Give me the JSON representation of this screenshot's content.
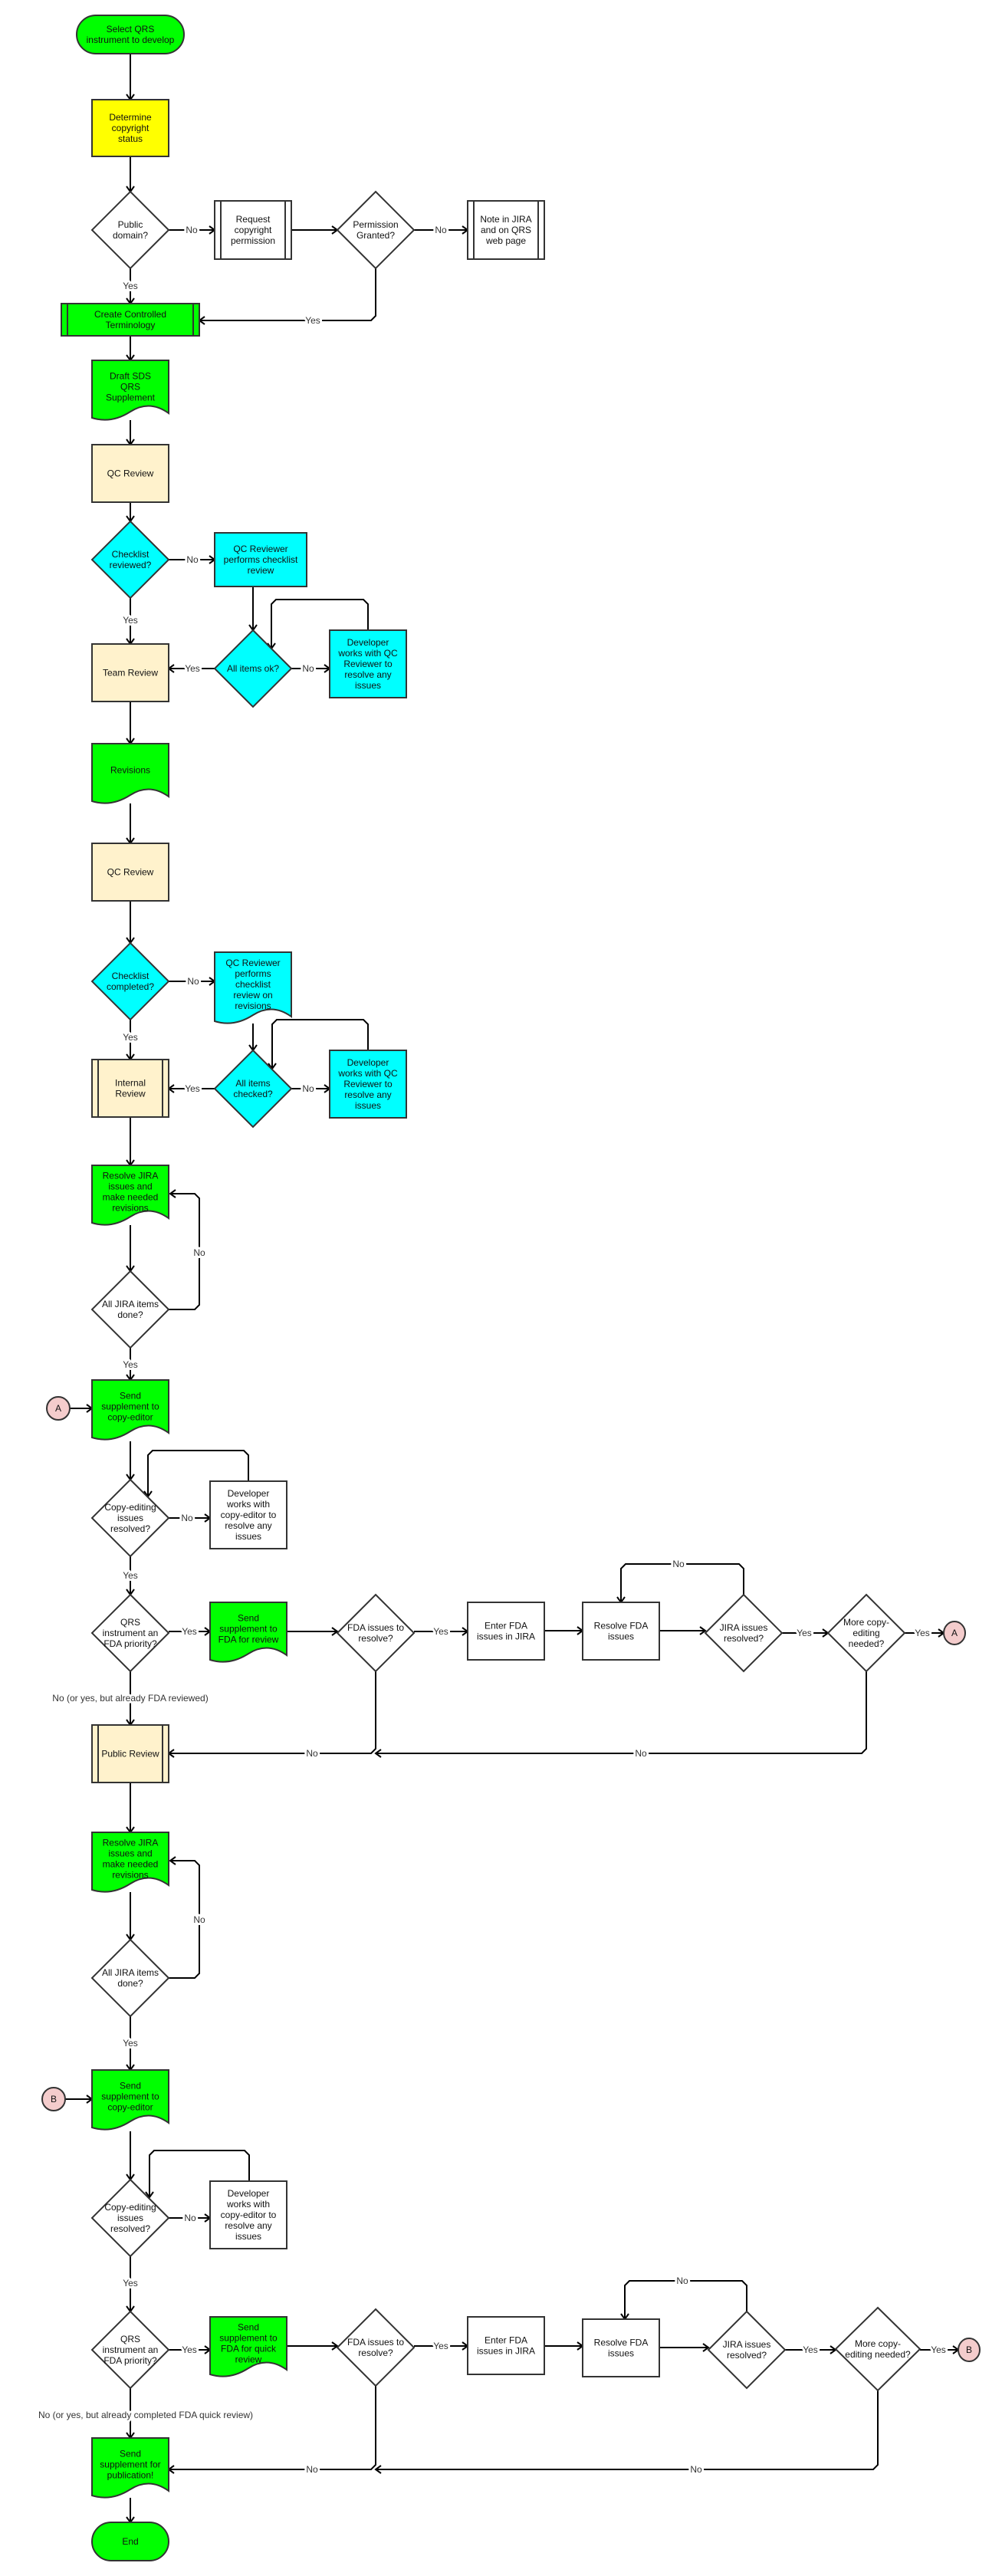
{
  "colors": {
    "green": "#00ff00",
    "yellow": "#ffff00",
    "cyan": "#00ffff",
    "cream": "#fff2cc",
    "white": "#ffffff",
    "pink": "#f4cccc",
    "stroke": "#333333",
    "edge": "#000000"
  },
  "nodes": [
    {
      "id": "start",
      "shape": "terminal",
      "fill": "green",
      "lines": [
        "Select QRS",
        "instrument to develop"
      ]
    },
    {
      "id": "determine",
      "shape": "process",
      "fill": "yellow",
      "lines": [
        "Determine",
        "copyright",
        "status"
      ]
    },
    {
      "id": "public",
      "shape": "decision",
      "fill": "white",
      "lines": [
        "Public",
        "domain?"
      ]
    },
    {
      "id": "request",
      "shape": "subprocess",
      "fill": "white",
      "lines": [
        "Request",
        "copyright",
        "permission"
      ]
    },
    {
      "id": "permission",
      "shape": "decision",
      "fill": "white",
      "lines": [
        "Permission",
        "Granted?"
      ]
    },
    {
      "id": "note",
      "shape": "subprocess",
      "fill": "white",
      "lines": [
        "Note in JIRA",
        "and on QRS",
        "web page"
      ]
    },
    {
      "id": "create",
      "shape": "subprocess",
      "fill": "green",
      "lines": [
        "Create Controlled",
        "Terminology"
      ]
    },
    {
      "id": "draft",
      "shape": "document",
      "fill": "green",
      "lines": [
        "Draft SDS",
        "QRS",
        "Supplement"
      ]
    },
    {
      "id": "qc1",
      "shape": "process",
      "fill": "cream",
      "lines": [
        "QC Review"
      ]
    },
    {
      "id": "checklist1",
      "shape": "decision",
      "fill": "cyan",
      "lines": [
        "Checklist",
        "reviewed?"
      ]
    },
    {
      "id": "qcr1",
      "shape": "process",
      "fill": "cyan",
      "lines": [
        "QC Reviewer",
        "performs checklist",
        "review"
      ]
    },
    {
      "id": "team",
      "shape": "process",
      "fill": "cream",
      "lines": [
        "Team Review"
      ]
    },
    {
      "id": "allok",
      "shape": "decision",
      "fill": "cyan",
      "lines": [
        "All items ok?"
      ]
    },
    {
      "id": "dev1",
      "shape": "process",
      "fill": "cyan",
      "lines": [
        "Developer",
        "works with QC",
        "Reviewer to",
        "resolve any",
        "issues"
      ]
    },
    {
      "id": "revisions",
      "shape": "document",
      "fill": "green",
      "lines": [
        "Revisions"
      ]
    },
    {
      "id": "qc2",
      "shape": "process",
      "fill": "cream",
      "lines": [
        "QC Review"
      ]
    },
    {
      "id": "checklist2",
      "shape": "decision",
      "fill": "cyan",
      "lines": [
        "Checklist",
        "completed?"
      ]
    },
    {
      "id": "qcr2",
      "shape": "document",
      "fill": "cyan",
      "lines": [
        "QC Reviewer",
        "performs",
        "checklist",
        "review on",
        "revisions"
      ]
    },
    {
      "id": "internal",
      "shape": "subprocess",
      "fill": "cream",
      "lines": [
        "Internal",
        "Review"
      ]
    },
    {
      "id": "allchecked",
      "shape": "decision",
      "fill": "cyan",
      "lines": [
        "All items",
        "checked?"
      ]
    },
    {
      "id": "dev2",
      "shape": "process",
      "fill": "cyan",
      "lines": [
        "Developer",
        "works with QC",
        "Reviewer to",
        "resolve any",
        "issues"
      ]
    },
    {
      "id": "resolve1",
      "shape": "document",
      "fill": "green",
      "lines": [
        "Resolve JIRA",
        "issues and",
        "make needed",
        "revisions"
      ]
    },
    {
      "id": "alljira1",
      "shape": "decision",
      "fill": "white",
      "lines": [
        "All JIRA items",
        "done?"
      ]
    },
    {
      "id": "send1",
      "shape": "document",
      "fill": "green",
      "lines": [
        "Send",
        "supplement to",
        "copy-editor"
      ]
    },
    {
      "id": "connA1",
      "shape": "connector",
      "fill": "pink",
      "lines": [
        "A"
      ]
    },
    {
      "id": "copyed1",
      "shape": "decision",
      "fill": "white",
      "lines": [
        "Copy-editing",
        "issues",
        "resolved?"
      ]
    },
    {
      "id": "devce1",
      "shape": "process",
      "fill": "white",
      "lines": [
        "Developer",
        "works with",
        "copy-editor to",
        "resolve any",
        "issues"
      ]
    },
    {
      "id": "prio1",
      "shape": "decision",
      "fill": "white",
      "lines": [
        "QRS",
        "instrument an",
        "FDA priority?"
      ]
    },
    {
      "id": "sendfda1",
      "shape": "document",
      "fill": "green",
      "lines": [
        "Send",
        "supplement to",
        "FDA for review"
      ]
    },
    {
      "id": "fdaiss1",
      "shape": "decision",
      "fill": "white",
      "lines": [
        "FDA issues to",
        "resolve?"
      ]
    },
    {
      "id": "enter1",
      "shape": "process",
      "fill": "white",
      "lines": [
        "Enter FDA",
        "issues in JIRA"
      ]
    },
    {
      "id": "resfda1",
      "shape": "process",
      "fill": "white",
      "lines": [
        "Resolve FDA",
        "issues"
      ]
    },
    {
      "id": "jirares1",
      "shape": "decision",
      "fill": "white",
      "lines": [
        "JIRA issues",
        "resolved?"
      ]
    },
    {
      "id": "more1",
      "shape": "decision",
      "fill": "white",
      "lines": [
        "More copy-",
        "editing",
        "needed?"
      ]
    },
    {
      "id": "connA2",
      "shape": "connector",
      "fill": "pink",
      "lines": [
        "A"
      ]
    },
    {
      "id": "publicreview",
      "shape": "subprocess",
      "fill": "cream",
      "lines": [
        "Public Review"
      ]
    },
    {
      "id": "resolve2",
      "shape": "document",
      "fill": "green",
      "lines": [
        "Resolve JIRA",
        "issues and",
        "make needed",
        "revisions"
      ]
    },
    {
      "id": "alljira2",
      "shape": "decision",
      "fill": "white",
      "lines": [
        "All JIRA items",
        "done?"
      ]
    },
    {
      "id": "send2",
      "shape": "document",
      "fill": "green",
      "lines": [
        "Send",
        "supplement to",
        "copy-editor"
      ]
    },
    {
      "id": "connB1",
      "shape": "connector",
      "fill": "pink",
      "lines": [
        "B"
      ]
    },
    {
      "id": "copyed2",
      "shape": "decision",
      "fill": "white",
      "lines": [
        "Copy-editing",
        "issues",
        "resolved?"
      ]
    },
    {
      "id": "devce2",
      "shape": "process",
      "fill": "white",
      "lines": [
        "Developer",
        "works with",
        "copy-editor to",
        "resolve any",
        "issues"
      ]
    },
    {
      "id": "prio2",
      "shape": "decision",
      "fill": "white",
      "lines": [
        "QRS",
        "instrument an",
        "FDA priority?"
      ]
    },
    {
      "id": "sendfda2",
      "shape": "document",
      "fill": "green",
      "lines": [
        "Send",
        "supplement to",
        "FDA for quick",
        "review"
      ]
    },
    {
      "id": "fdaiss2",
      "shape": "decision",
      "fill": "white",
      "lines": [
        "FDA issues to",
        "resolve?"
      ]
    },
    {
      "id": "enter2",
      "shape": "process",
      "fill": "white",
      "lines": [
        "Enter FDA",
        "issues in JIRA"
      ]
    },
    {
      "id": "resfda2",
      "shape": "process",
      "fill": "white",
      "lines": [
        "Resolve FDA",
        "issues"
      ]
    },
    {
      "id": "jirares2",
      "shape": "decision",
      "fill": "white",
      "lines": [
        "JIRA issues",
        "resolved?"
      ]
    },
    {
      "id": "more2",
      "shape": "decision",
      "fill": "white",
      "lines": [
        "More copy-",
        "editing needed?"
      ]
    },
    {
      "id": "connB2",
      "shape": "connector",
      "fill": "pink",
      "lines": [
        "B"
      ]
    },
    {
      "id": "publication",
      "shape": "document",
      "fill": "green",
      "lines": [
        "Send",
        "supplement for",
        "publication!"
      ]
    },
    {
      "id": "end",
      "shape": "terminal",
      "fill": "green",
      "lines": [
        "End"
      ]
    }
  ],
  "edges": [
    {
      "from": "start",
      "to": "determine",
      "label": ""
    },
    {
      "from": "determine",
      "to": "public",
      "label": ""
    },
    {
      "from": "public",
      "to": "request",
      "label": "No"
    },
    {
      "from": "request",
      "to": "permission",
      "label": ""
    },
    {
      "from": "permission",
      "to": "note",
      "label": "No"
    },
    {
      "from": "public",
      "to": "create",
      "label": "Yes"
    },
    {
      "from": "permission",
      "to": "create",
      "label": "Yes"
    },
    {
      "from": "create",
      "to": "draft",
      "label": ""
    },
    {
      "from": "draft",
      "to": "qc1",
      "label": ""
    },
    {
      "from": "qc1",
      "to": "checklist1",
      "label": ""
    },
    {
      "from": "checklist1",
      "to": "qcr1",
      "label": "No"
    },
    {
      "from": "checklist1",
      "to": "team",
      "label": "Yes"
    },
    {
      "from": "qcr1",
      "to": "allok",
      "label": ""
    },
    {
      "from": "allok",
      "to": "team",
      "label": "Yes"
    },
    {
      "from": "allok",
      "to": "dev1",
      "label": "No"
    },
    {
      "from": "dev1",
      "to": "allok",
      "label": ""
    },
    {
      "from": "team",
      "to": "revisions",
      "label": ""
    },
    {
      "from": "revisions",
      "to": "qc2",
      "label": ""
    },
    {
      "from": "qc2",
      "to": "checklist2",
      "label": ""
    },
    {
      "from": "checklist2",
      "to": "qcr2",
      "label": "No"
    },
    {
      "from": "checklist2",
      "to": "internal",
      "label": "Yes"
    },
    {
      "from": "qcr2",
      "to": "allchecked",
      "label": ""
    },
    {
      "from": "allchecked",
      "to": "internal",
      "label": "Yes"
    },
    {
      "from": "allchecked",
      "to": "dev2",
      "label": "No"
    },
    {
      "from": "dev2",
      "to": "allchecked",
      "label": ""
    },
    {
      "from": "internal",
      "to": "resolve1",
      "label": ""
    },
    {
      "from": "resolve1",
      "to": "alljira1",
      "label": ""
    },
    {
      "from": "alljira1",
      "to": "resolve1",
      "label": "No"
    },
    {
      "from": "alljira1",
      "to": "send1",
      "label": "Yes"
    },
    {
      "from": "connA1",
      "to": "send1",
      "label": ""
    },
    {
      "from": "send1",
      "to": "copyed1",
      "label": ""
    },
    {
      "from": "copyed1",
      "to": "devce1",
      "label": "No"
    },
    {
      "from": "devce1",
      "to": "copyed1",
      "label": ""
    },
    {
      "from": "copyed1",
      "to": "prio1",
      "label": "Yes"
    },
    {
      "from": "prio1",
      "to": "sendfda1",
      "label": "Yes"
    },
    {
      "from": "sendfda1",
      "to": "fdaiss1",
      "label": ""
    },
    {
      "from": "fdaiss1",
      "to": "enter1",
      "label": "Yes"
    },
    {
      "from": "enter1",
      "to": "resfda1",
      "label": ""
    },
    {
      "from": "resfda1",
      "to": "jirares1",
      "label": ""
    },
    {
      "from": "jirares1",
      "to": "resfda1",
      "label": "No"
    },
    {
      "from": "jirares1",
      "to": "more1",
      "label": "Yes"
    },
    {
      "from": "more1",
      "to": "connA2",
      "label": "Yes"
    },
    {
      "from": "more1",
      "to": "publicreview",
      "label": "No"
    },
    {
      "from": "fdaiss1",
      "to": "publicreview",
      "label": "No"
    },
    {
      "from": "prio1",
      "to": "publicreview",
      "label": "No (or yes, but already FDA reviewed)"
    },
    {
      "from": "publicreview",
      "to": "resolve2",
      "label": ""
    },
    {
      "from": "resolve2",
      "to": "alljira2",
      "label": ""
    },
    {
      "from": "alljira2",
      "to": "resolve2",
      "label": "No"
    },
    {
      "from": "alljira2",
      "to": "send2",
      "label": "Yes"
    },
    {
      "from": "connB1",
      "to": "send2",
      "label": ""
    },
    {
      "from": "send2",
      "to": "copyed2",
      "label": ""
    },
    {
      "from": "copyed2",
      "to": "devce2",
      "label": "No"
    },
    {
      "from": "devce2",
      "to": "copyed2",
      "label": ""
    },
    {
      "from": "copyed2",
      "to": "prio2",
      "label": "Yes"
    },
    {
      "from": "prio2",
      "to": "sendfda2",
      "label": "Yes"
    },
    {
      "from": "sendfda2",
      "to": "fdaiss2",
      "label": ""
    },
    {
      "from": "fdaiss2",
      "to": "enter2",
      "label": "Yes"
    },
    {
      "from": "enter2",
      "to": "resfda2",
      "label": ""
    },
    {
      "from": "resfda2",
      "to": "jirares2",
      "label": ""
    },
    {
      "from": "jirares2",
      "to": "resfda2",
      "label": "No"
    },
    {
      "from": "jirares2",
      "to": "more2",
      "label": "Yes"
    },
    {
      "from": "more2",
      "to": "connB2",
      "label": "Yes"
    },
    {
      "from": "more2",
      "to": "publication",
      "label": "No"
    },
    {
      "from": "fdaiss2",
      "to": "publication",
      "label": "No"
    },
    {
      "from": "prio2",
      "to": "publication",
      "label": "No (or yes, but already completed FDA quick review)"
    },
    {
      "from": "publication",
      "to": "end",
      "label": ""
    }
  ]
}
